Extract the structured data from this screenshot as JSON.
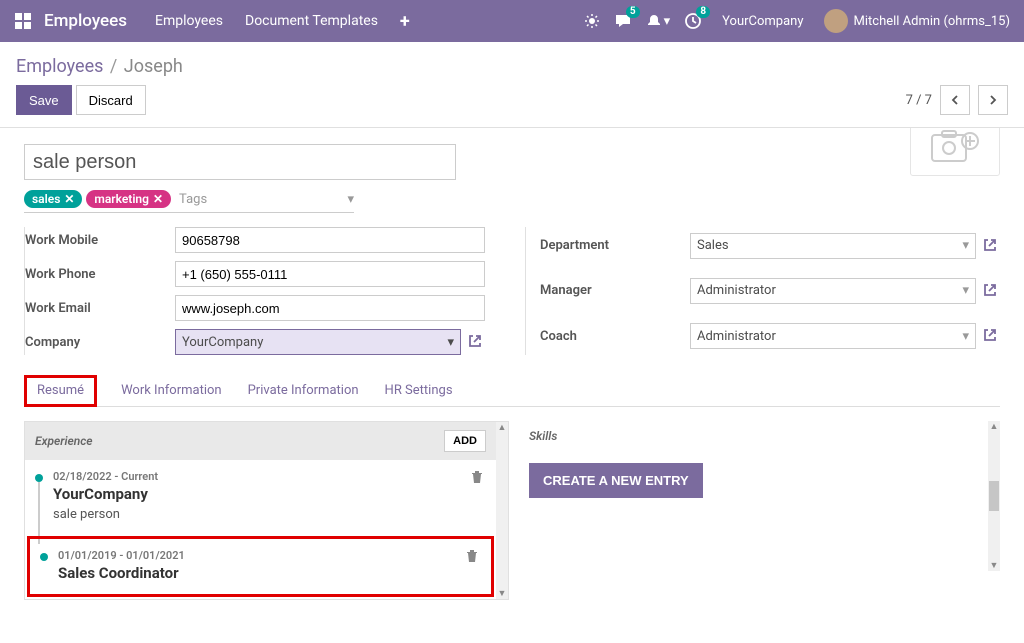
{
  "topbar": {
    "brand": "Employees",
    "nav": [
      "Employees",
      "Document Templates"
    ],
    "msg_badge": "5",
    "act_badge": "8",
    "company": "YourCompany",
    "user": "Mitchell Admin (ohrms_15)"
  },
  "breadcrumb": {
    "root": "Employees",
    "current": "Joseph"
  },
  "actions": {
    "save": "Save",
    "discard": "Discard",
    "pager": "7 / 7"
  },
  "form": {
    "title": "sale person",
    "tags": [
      {
        "label": "sales",
        "cls": "sales"
      },
      {
        "label": "marketing",
        "cls": "marketing"
      }
    ],
    "tags_placeholder": "Tags",
    "left": {
      "work_mobile": {
        "label": "Work Mobile",
        "value": "90658798"
      },
      "work_phone": {
        "label": "Work Phone",
        "value": "+1 (650) 555-0111"
      },
      "work_email": {
        "label": "Work Email",
        "value": "www.joseph.com"
      },
      "company": {
        "label": "Company",
        "value": "YourCompany"
      }
    },
    "right": {
      "department": {
        "label": "Department",
        "value": "Sales"
      },
      "manager": {
        "label": "Manager",
        "value": "Administrator"
      },
      "coach": {
        "label": "Coach",
        "value": "Administrator"
      }
    }
  },
  "tabs": [
    "Resumé",
    "Work Information",
    "Private Information",
    "HR Settings"
  ],
  "experience": {
    "header": "Experience",
    "add": "ADD",
    "items": [
      {
        "dates": "02/18/2022 - Current",
        "title": "YourCompany",
        "sub": "sale person"
      },
      {
        "dates": "01/01/2019 - 01/01/2021",
        "title": "Sales Coordinator",
        "sub": ""
      }
    ]
  },
  "skills": {
    "header": "Skills",
    "new": "CREATE A NEW ENTRY"
  }
}
